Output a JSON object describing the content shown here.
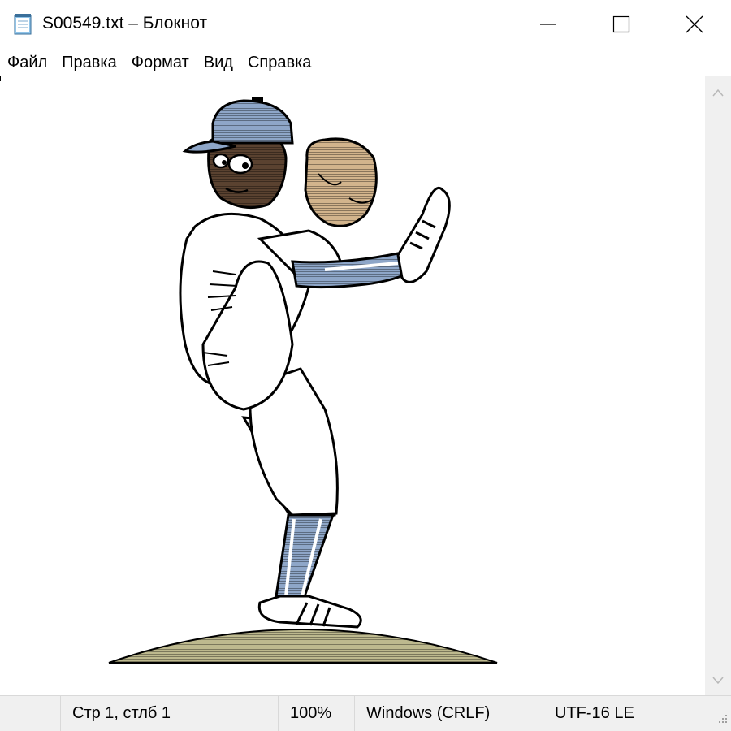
{
  "window": {
    "title": "S00549.txt – Блокнот",
    "icon": "notepad-icon",
    "controls": [
      "minimize-icon",
      "maximize-icon",
      "close-icon"
    ]
  },
  "menu": {
    "items": [
      {
        "label": "Файл"
      },
      {
        "label": "Правка"
      },
      {
        "label": "Формат"
      },
      {
        "label": "Вид"
      },
      {
        "label": "Справка"
      }
    ]
  },
  "document": {
    "content_description_icon": "ascii-art-baseball-pitcher",
    "colors": {
      "cap": "#8ea6c8",
      "skin": "#5a4230",
      "glove": "#d2b48c",
      "socks": "#8ea6c8",
      "mound": "#bdb98e",
      "outline": "#000000"
    }
  },
  "statusbar": {
    "position": "Стр 1, стлб 1",
    "zoom": "100%",
    "line_endings": "Windows (CRLF)",
    "encoding": "UTF-16 LE"
  }
}
